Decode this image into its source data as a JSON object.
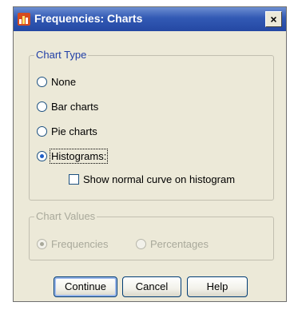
{
  "window": {
    "title": "Frequencies: Charts",
    "close_label": "×"
  },
  "chart_type": {
    "legend": "Chart Type",
    "options": [
      {
        "label": "None",
        "checked": false
      },
      {
        "label": "Bar charts",
        "checked": false
      },
      {
        "label": "Pie charts",
        "checked": false
      },
      {
        "label": "Histograms:",
        "checked": true
      }
    ],
    "normal_curve_label": "Show normal curve on histogram",
    "normal_curve_checked": false
  },
  "chart_values": {
    "legend": "Chart Values",
    "options": [
      {
        "label": "Frequencies",
        "checked": true,
        "enabled": false
      },
      {
        "label": "Percentages",
        "checked": false,
        "enabled": false
      }
    ]
  },
  "buttons": {
    "continue": "Continue",
    "cancel": "Cancel",
    "help": "Help"
  },
  "colors": {
    "titlebar": "#2c55b3",
    "dialog_bg": "#ece9d8",
    "legend_text": "#1f3ea6"
  }
}
